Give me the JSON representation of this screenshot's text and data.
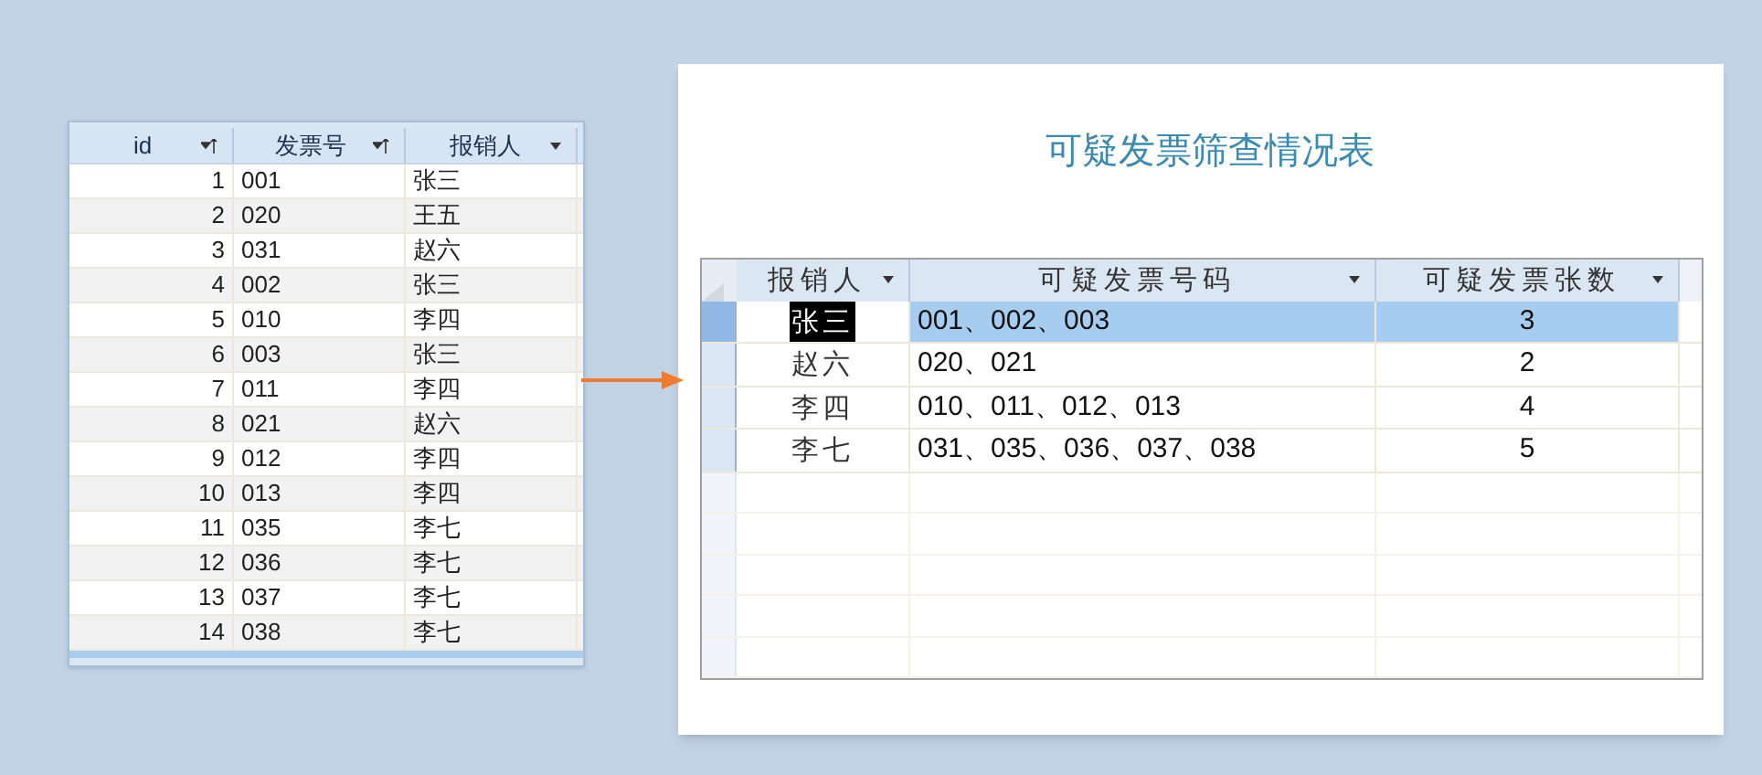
{
  "source_table": {
    "columns": [
      {
        "label": "id",
        "kind": "sorted"
      },
      {
        "label": "发票号",
        "kind": "sorted"
      },
      {
        "label": "报销人",
        "kind": "filter"
      }
    ],
    "rows": [
      [
        "1",
        "001",
        "张三"
      ],
      [
        "2",
        "020",
        "王五"
      ],
      [
        "3",
        "031",
        "赵六"
      ],
      [
        "4",
        "002",
        "张三"
      ],
      [
        "5",
        "010",
        "李四"
      ],
      [
        "6",
        "003",
        "张三"
      ],
      [
        "7",
        "011",
        "李四"
      ],
      [
        "8",
        "021",
        "赵六"
      ],
      [
        "9",
        "012",
        "李四"
      ],
      [
        "10",
        "013",
        "李四"
      ],
      [
        "11",
        "035",
        "李七"
      ],
      [
        "12",
        "036",
        "李七"
      ],
      [
        "13",
        "037",
        "李七"
      ],
      [
        "14",
        "038",
        "李七"
      ]
    ]
  },
  "report": {
    "title": "可疑发票筛查情况表",
    "columns": [
      "报销人",
      "可疑发票号码",
      "可疑发票张数"
    ],
    "rows": [
      {
        "person": "张三",
        "invoices": "001、002、003",
        "count": "3",
        "selected": true
      },
      {
        "person": "赵六",
        "invoices": "020、021",
        "count": "2",
        "selected": false
      },
      {
        "person": "李四",
        "invoices": "010、011、012、013",
        "count": "4",
        "selected": false
      },
      {
        "person": "李七",
        "invoices": "031、035、036、037、038",
        "count": "5",
        "selected": false
      }
    ]
  }
}
